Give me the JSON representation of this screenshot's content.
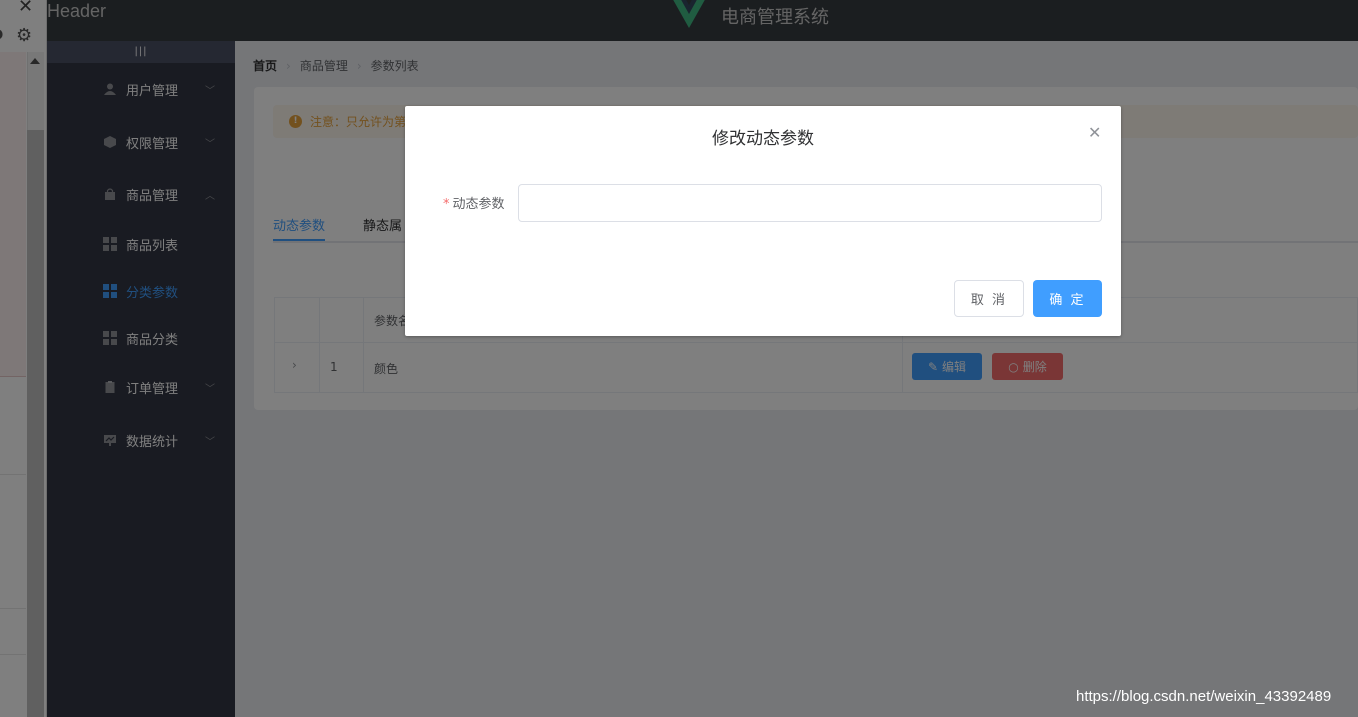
{
  "header": {
    "label": "Header",
    "app_title": "电商管理系统",
    "logo_color": "#41b883"
  },
  "sidebar": {
    "toggle": "|||",
    "menus": [
      {
        "label": "用户管理",
        "icon": "user-icon"
      },
      {
        "label": "权限管理",
        "icon": "box-icon"
      },
      {
        "label": "商品管理",
        "icon": "bag-icon"
      },
      {
        "label": "订单管理",
        "icon": "clipboard-icon"
      },
      {
        "label": "数据统计",
        "icon": "chart-icon"
      }
    ],
    "submenus": [
      {
        "label": "商品列表",
        "icon": "grid-icon"
      },
      {
        "label": "分类参数",
        "icon": "grid-icon"
      },
      {
        "label": "商品分类",
        "icon": "grid-icon"
      }
    ]
  },
  "breadcrumb": {
    "home": "首页",
    "level1": "商品管理",
    "level2": "参数列表"
  },
  "alert": {
    "text": "注意：只允许为第"
  },
  "tabs": {
    "dynamic": "动态参数",
    "static": "静态属"
  },
  "table": {
    "header_name": "参数名",
    "rows": [
      {
        "index": "1",
        "name": "颜色"
      }
    ],
    "edit_label": "编辑",
    "delete_label": "删除"
  },
  "dialog": {
    "title": "修改动态参数",
    "field_required_mark": "*",
    "field_label": "动态参数",
    "field_value": "",
    "cancel_label": "取 消",
    "ok_label": "确 定"
  },
  "watermark": "https://blog.csdn.net/weixin_43392489",
  "colors": {
    "primary": "#409eff",
    "danger": "#f56c6c",
    "warning": "#e6a23c",
    "sidebar_bg": "#333744",
    "header_bg": "#373d41"
  }
}
